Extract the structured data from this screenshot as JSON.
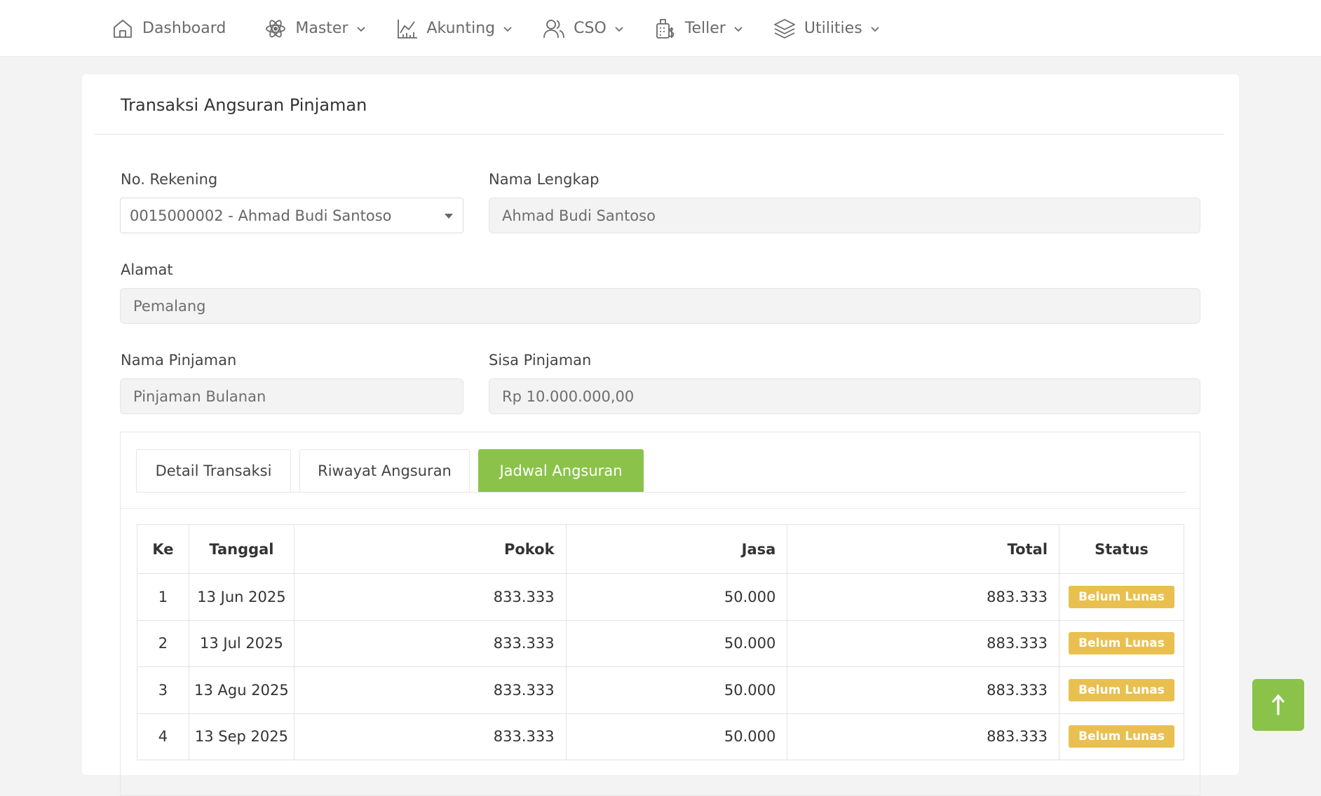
{
  "nav": {
    "items": [
      {
        "label": "Dashboard",
        "icon": "home-icon",
        "has_dropdown": false
      },
      {
        "label": "Master",
        "icon": "atom-icon",
        "has_dropdown": true
      },
      {
        "label": "Akunting",
        "icon": "chart-icon",
        "has_dropdown": true
      },
      {
        "label": "CSO",
        "icon": "users-icon",
        "has_dropdown": true
      },
      {
        "label": "Teller",
        "icon": "receipt-icon",
        "has_dropdown": true
      },
      {
        "label": "Utilities",
        "icon": "layers-icon",
        "has_dropdown": true
      }
    ]
  },
  "page": {
    "title": "Transaksi Angsuran Pinjaman"
  },
  "form": {
    "no_rekening_label": "No. Rekening",
    "no_rekening_value": "0015000002 - Ahmad Budi Santoso",
    "nama_lengkap_label": "Nama Lengkap",
    "nama_lengkap_value": "Ahmad Budi Santoso",
    "alamat_label": "Alamat",
    "alamat_value": "Pemalang",
    "nama_pinjaman_label": "Nama Pinjaman",
    "nama_pinjaman_value": "Pinjaman Bulanan",
    "sisa_pinjaman_label": "Sisa Pinjaman",
    "sisa_pinjaman_value": "Rp 10.000.000,00"
  },
  "tabs": [
    {
      "label": "Detail Transaksi",
      "active": false
    },
    {
      "label": "Riwayat Angsuran",
      "active": false
    },
    {
      "label": "Jadwal Angsuran",
      "active": true
    }
  ],
  "schedule": {
    "headers": [
      "Ke",
      "Tanggal",
      "Pokok",
      "Jasa",
      "Total",
      "Status"
    ],
    "rows": [
      {
        "ke": "1",
        "tanggal": "13 Jun 2025",
        "pokok": "833.333",
        "jasa": "50.000",
        "total": "883.333",
        "status": "Belum Lunas"
      },
      {
        "ke": "2",
        "tanggal": "13 Jul 2025",
        "pokok": "833.333",
        "jasa": "50.000",
        "total": "883.333",
        "status": "Belum Lunas"
      },
      {
        "ke": "3",
        "tanggal": "13 Agu 2025",
        "pokok": "833.333",
        "jasa": "50.000",
        "total": "883.333",
        "status": "Belum Lunas"
      },
      {
        "ke": "4",
        "tanggal": "13 Sep 2025",
        "pokok": "833.333",
        "jasa": "50.000",
        "total": "883.333",
        "status": "Belum Lunas"
      }
    ]
  },
  "colors": {
    "accent_green": "#8bc34a",
    "badge_yellow": "#e9c04f"
  },
  "scroll_top": {
    "icon": "arrow-up-icon"
  }
}
